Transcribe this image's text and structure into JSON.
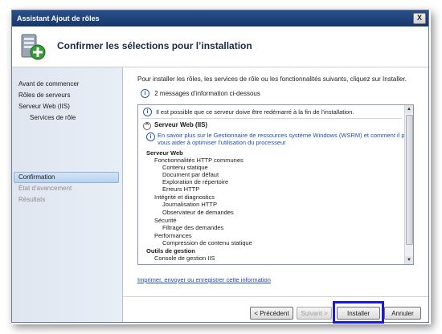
{
  "window": {
    "title": "Assistant Ajout de rôles",
    "close_label": "X"
  },
  "header": {
    "title": "Confirmer les sélections pour l’installation"
  },
  "sidebar": {
    "items": [
      {
        "label": "Avant de commencer"
      },
      {
        "label": "Rôles de serveurs"
      },
      {
        "label": "Serveur Web (IIS)"
      },
      {
        "label": "Services de rôle"
      },
      {
        "label": "Confirmation"
      },
      {
        "label": "État d’avancement"
      },
      {
        "label": "Résultats"
      }
    ]
  },
  "main": {
    "intro": "Pour installer les rôles, les services de rôle ou les fonctionnalités suivants, cliquez sur Installer.",
    "message_count": "2 messages d’information ci-dessous",
    "panel": {
      "restart_note": "Il est possible que ce serveur doive être redémarré à la fin de l’installation.",
      "section_title": "Serveur Web (IIS)",
      "wsrm_line1": "En savoir plus sur le Gestionnaire de ressources système Windows (WSRM) et comment il peut",
      "wsrm_line2": "vous aider à optimiser l’utilisation du processeur",
      "tree": [
        "Serveur Web",
        "Fonctionnalités HTTP communes",
        "Contenu statique",
        "Document par défaut",
        "Exploration de répertoire",
        "Erreurs HTTP",
        "Intégrité et diagnostics",
        "Journalisation HTTP",
        "Observateur de demandes",
        "Sécurité",
        "Filtrage des demandes",
        "Performances",
        "Compression de contenu statique",
        "Outils de gestion",
        "Console de gestion IIS"
      ]
    },
    "link": "Imprimer, envoyer ou enregistrer cette information"
  },
  "buttons": {
    "previous": "< Précédent",
    "next": "Suivant >",
    "install": "Installer",
    "cancel": "Annuler"
  },
  "icons": {
    "info": "info-icon",
    "collapse": "collapse-icon",
    "server": "server-icon"
  }
}
